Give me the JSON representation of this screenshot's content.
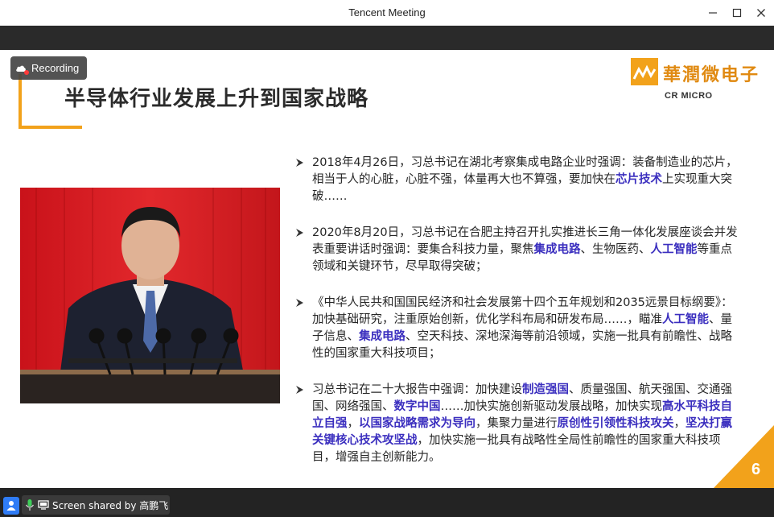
{
  "window": {
    "title": "Tencent Meeting"
  },
  "recording": {
    "label": "Recording"
  },
  "slide": {
    "title": "半导体行业发展上升到国家战略",
    "logo_cn": "華潤微电子",
    "logo_en": "CR MICRO",
    "page_number": "6",
    "bullets": [
      {
        "segments": [
          {
            "text": "2018年4月26日，习总书记在湖北考察集成电路企业时强调：装备制造业的芯片，相当于人的心脏，心脏不强，体量再大也不算强，要加快在",
            "hl": false
          },
          {
            "text": "芯片技术",
            "hl": true
          },
          {
            "text": "上实现重大突破……",
            "hl": false
          }
        ]
      },
      {
        "segments": [
          {
            "text": "2020年8月20日，习总书记在合肥主持召开扎实推进长三角一体化发展座谈会并发表重要讲话时强调：要集合科技力量，聚焦",
            "hl": false
          },
          {
            "text": "集成电路",
            "hl": true
          },
          {
            "text": "、生物医药、",
            "hl": false
          },
          {
            "text": "人工智能",
            "hl": true
          },
          {
            "text": "等重点领域和关键环节，尽早取得突破；",
            "hl": false
          }
        ]
      },
      {
        "segments": [
          {
            "text": "《中华人民共和国国民经济和社会发展第十四个五年规划和2035远景目标纲要》：加快基础研究，注重原始创新，优化学科布局和研发布局……，瞄准",
            "hl": false
          },
          {
            "text": "人工智能",
            "hl": true
          },
          {
            "text": "、量子信息、",
            "hl": false
          },
          {
            "text": "集成电路",
            "hl": true
          },
          {
            "text": "、空天科技、深地深海等前沿领域，实施一批具有前瞻性、战略性的国家重大科技项目；",
            "hl": false
          }
        ]
      },
      {
        "segments": [
          {
            "text": "习总书记在二十大报告中强调：加快建设",
            "hl": false
          },
          {
            "text": "制造强国",
            "hl": true
          },
          {
            "text": "、质量强国、航天强国、交通强国、网络强国、",
            "hl": false
          },
          {
            "text": "数字中国",
            "hl": true
          },
          {
            "text": "……加快实施创新驱动发展战略，加快实现",
            "hl": false
          },
          {
            "text": "高水平科技自立自强",
            "hl": true
          },
          {
            "text": "，",
            "hl": false
          },
          {
            "text": "以国家战略需求为导向",
            "hl": true
          },
          {
            "text": "，集聚力量进行",
            "hl": false
          },
          {
            "text": "原创性引领性科技攻关",
            "hl": true
          },
          {
            "text": "，",
            "hl": false
          },
          {
            "text": "坚决打赢关键核心技术攻坚战",
            "hl": true
          },
          {
            "text": "，加快实施一批具有战略性全局性前瞻性的国家重大科技项目，增强自主创新能力。",
            "hl": false
          }
        ]
      }
    ]
  },
  "status": {
    "screen_share": "Screen shared by 高鹏飞"
  },
  "colors": {
    "accent_orange": "#f2a21b",
    "highlight_purple": "#3b2fbf",
    "toolbar_dark": "#2a2a2a",
    "person_blue": "#2f7cf6"
  },
  "icons": {
    "minimize": "minimize-icon",
    "maximize": "maximize-icon",
    "close": "close-icon",
    "recording": "cloud-record-icon",
    "bullet": "arrow-bullet-icon",
    "person": "person-icon",
    "microphone": "microphone-icon",
    "screen": "screen-share-icon"
  }
}
